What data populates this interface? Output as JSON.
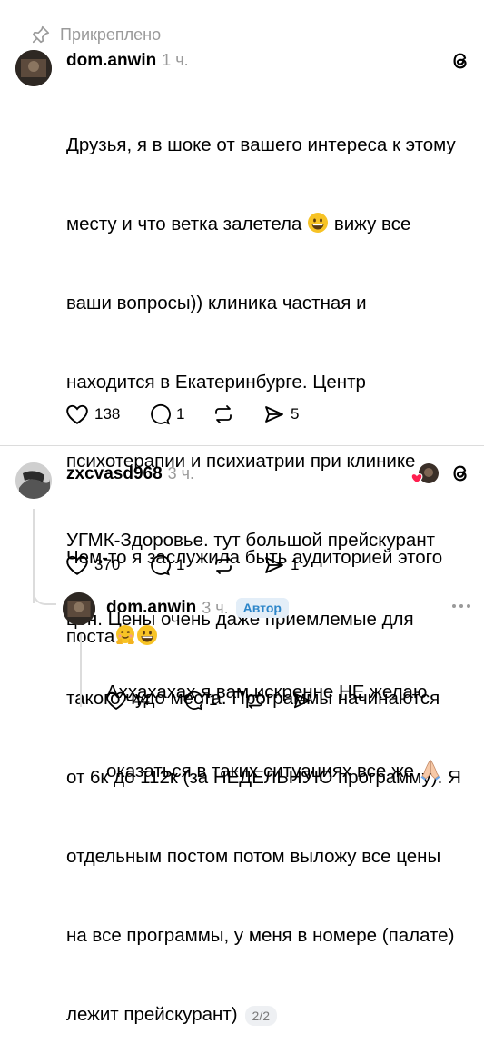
{
  "pinned": {
    "label": "Прикреплено"
  },
  "post1": {
    "username": "dom.anwin",
    "time": "1 ч.",
    "text_lines": [
      "Друзья, я в шоке от вашего интереса к этому",
      "месту и что ветка залетела",
      "вижу все",
      "ваши вопросы)) клиника частная и",
      "находится в Екатеринбурге. Центр",
      "психотерапии и психиатрии при клинике",
      "УГМК-Здоровье. тут большой прейскурант",
      "цен. Цены очень даже приемлемые для",
      "такого чудо места. Программы начинаются",
      "от 6к до 112к (за НЕДЕЛЬНУЮ программу). Я",
      "отдельным постом потом выложу все цены",
      "на все программы, у меня в номере (палате)",
      "лежит прейскурант)"
    ],
    "page_badge": "2/2",
    "likes": "138",
    "replies": "1",
    "shares": "5"
  },
  "post2": {
    "username": "zxcvasd968",
    "time": "3 ч.",
    "text_lines": [
      "Чем-то я заслужила быть аудиторией этого",
      "поста"
    ],
    "likes": "370",
    "replies": "1",
    "shares": "1"
  },
  "post3": {
    "username": "dom.anwin",
    "time": "3 ч.",
    "author_label": "Автор",
    "text_lines": [
      "Аххахахах я вам искренне НЕ желаю",
      "оказаться в таких ситуациях все же"
    ],
    "likes": "44",
    "replies": "1"
  },
  "icons": {
    "pin": "pin-icon",
    "threads": "threads-logo-icon",
    "like": "heart-icon",
    "reply": "comment-icon",
    "repost": "repost-icon",
    "share": "send-icon",
    "more": "more-icon"
  },
  "colors": {
    "meta_gray": "#9a9a9a",
    "author_blue": "#2d86c9",
    "divider": "#dcdcdc"
  }
}
